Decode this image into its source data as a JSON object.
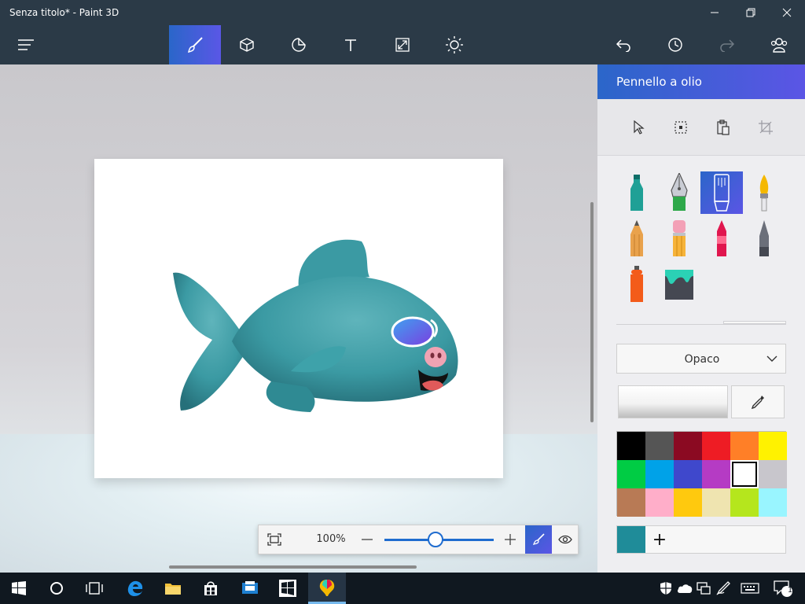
{
  "window": {
    "title": "Senza titolo* - Paint 3D",
    "controls": [
      "minimize-icon",
      "maximize-icon",
      "close-icon"
    ]
  },
  "toolbar": {
    "menu_icon": "hamburger-icon",
    "tools": [
      {
        "name": "brushes",
        "icon": "brush-icon",
        "active": true
      },
      {
        "name": "3d-shapes",
        "icon": "cube-icon",
        "active": false
      },
      {
        "name": "stickers",
        "icon": "sticker-icon",
        "active": false
      },
      {
        "name": "text",
        "icon": "text-icon",
        "active": false
      },
      {
        "name": "canvas",
        "icon": "resize-icon",
        "active": false
      },
      {
        "name": "effects",
        "icon": "sun-icon",
        "active": false
      }
    ],
    "right": [
      "undo-icon",
      "history-icon",
      "redo-icon",
      "people-icon"
    ]
  },
  "zoom": {
    "value": "100%",
    "slider_fraction": 0.47,
    "buttons": [
      "fit-icon",
      "minus-icon",
      "plus-icon",
      "brush-icon",
      "eye-icon"
    ]
  },
  "panel": {
    "title": "Pennello a olio",
    "selection_tools": [
      "cursor-icon",
      "select-icon",
      "paste-icon",
      "crop-icon"
    ],
    "brushes": [
      {
        "name": "marker",
        "color": "#1fa096"
      },
      {
        "name": "calligraphy-pen",
        "color": "#7c7c84"
      },
      {
        "name": "oil-brush",
        "color": "#ffffff",
        "active": true
      },
      {
        "name": "watercolor",
        "color": "#f5b800"
      },
      {
        "name": "pencil",
        "color": "#e9a24c"
      },
      {
        "name": "eraser",
        "color": "#f3a0b6"
      },
      {
        "name": "crayon",
        "color": "#e0164e"
      },
      {
        "name": "pixel-pen",
        "color": "#6b6f7a"
      },
      {
        "name": "spray-can",
        "color": "#f35b1a"
      },
      {
        "name": "fill",
        "color": "#2bd1b5"
      }
    ],
    "opacity_label": "Opaco",
    "palette": [
      "#000000",
      "#555555",
      "#8b0a22",
      "#ee1c24",
      "#ff7f27",
      "#fff200",
      "#00cc44",
      "#00a2e8",
      "#3f48cc",
      "#b53bc4",
      "#ffffff",
      "#c8c6cc",
      "#b87a55",
      "#ffaec9",
      "#ffc90e",
      "#efe4b0",
      "#b5e61d",
      "#99f5ff"
    ],
    "selected_palette_index": 10,
    "current_color": "#1f8c99",
    "add_label": "+"
  },
  "taskbar": {
    "apps": [
      "windows-start-icon",
      "cortana-icon",
      "task-view-icon",
      "edge-icon",
      "file-explorer-icon",
      "store-icon",
      "printer-app-icon",
      "windows-tile-icon",
      "paint3d-icon"
    ],
    "tray": [
      "shield-icon",
      "onedrive-icon",
      "network-icon",
      "pen-icon",
      "keyboard-icon",
      "notification-icon"
    ],
    "notification_count": "1"
  }
}
